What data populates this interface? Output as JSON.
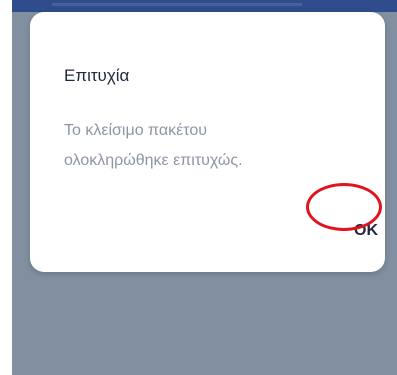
{
  "dialog": {
    "title": "Επιτυχία",
    "message_line1": "Το κλείσιμο πακέτου",
    "message_line2": "ολοκληρώθηκε επιτυχώς.",
    "ok_label": "OK"
  },
  "colors": {
    "overlay_background": "#818fa1",
    "header_strip": "#2f4d8c",
    "dialog_background": "#ffffff",
    "title_text": "#1f2a3d",
    "message_text": "#8e96a4",
    "highlight_ring": "#e3131b"
  }
}
